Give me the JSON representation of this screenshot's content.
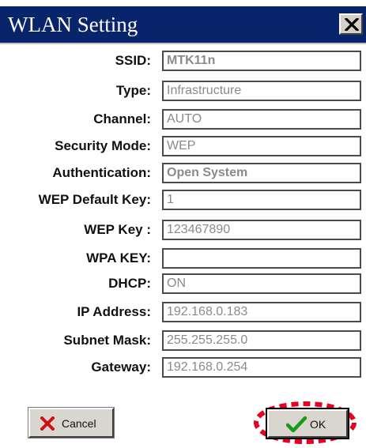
{
  "window": {
    "title": "WLAN Setting",
    "close_icon": "close-icon"
  },
  "fields": [
    {
      "label": "SSID:",
      "value": "MTK11n"
    },
    {
      "label": "Type:",
      "value": "Infrastructure"
    },
    {
      "label": "Channel:",
      "value": "AUTO"
    },
    {
      "label": "Security Mode:",
      "value": "WEP"
    },
    {
      "label": "Authentication:",
      "value": "Open System"
    },
    {
      "label": "WEP Default Key:",
      "value": "1"
    },
    {
      "label": "WEP Key :",
      "value": "123467890"
    },
    {
      "label": "WPA KEY:",
      "value": ""
    },
    {
      "label": "DHCP:",
      "value": "ON"
    },
    {
      "label": "IP Address:",
      "value": "192.168.0.183"
    },
    {
      "label": "Subnet Mask:",
      "value": "255.255.255.0"
    },
    {
      "label": "Gateway:",
      "value": "192.168.0.254"
    }
  ],
  "buttons": {
    "cancel_label": "Cancel",
    "cancel_icon": "x-icon",
    "ok_label": "OK",
    "ok_icon": "checkmark-icon"
  },
  "colors": {
    "titlebar": "#08246b",
    "highlight": "#e8001c",
    "cancel_x": "#d01010",
    "ok_check": "#1a9a1a"
  }
}
